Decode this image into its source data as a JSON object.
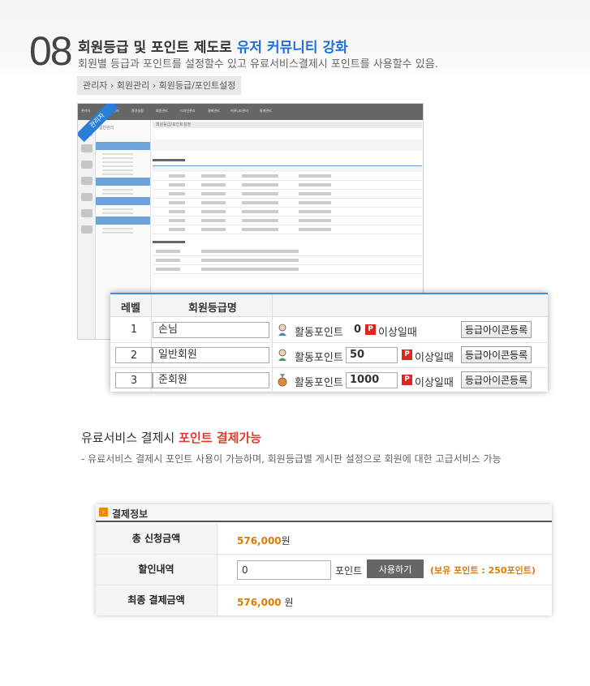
{
  "header": {
    "number": "08",
    "title": "회원등급 및 포인트 제도로",
    "title_highlight": "유저 커뮤니티 강화",
    "subtitle": "회원별 등급과 포인트를 설정할수 있고 유료서비스결제시 포인트를 사용할수 있음.",
    "breadcrumb": "관리자 › 회원관리 › 회원등급/포인트설정"
  },
  "admin_preview": {
    "ribbon": "관리자",
    "side_title": "일반관리",
    "page_heading": "회원등급/포인트설정",
    "nav": [
      "관리자",
      "일반관리",
      "환경설정",
      "회원관리",
      "디자인관리",
      "결제관리",
      "커뮤니티관리",
      "통계관리"
    ]
  },
  "grade_table": {
    "headers": {
      "level": "레벨",
      "name": "회원등급명"
    },
    "rows": [
      {
        "level": "1",
        "name": "손님",
        "label": "활동포인트",
        "points": "0",
        "condition": "이상일때",
        "button": "등급아이콘등록",
        "badge": "P"
      },
      {
        "level": "2",
        "name": "일반회원",
        "label": "활동포인트",
        "points": "50",
        "condition": "이상일때",
        "button": "등급아이콘등록",
        "badge": "P"
      },
      {
        "level": "3",
        "name": "준회원",
        "label": "활동포인트",
        "points": "1000",
        "condition": "이상일때",
        "button": "등급아이콘등록",
        "badge": "P"
      }
    ]
  },
  "section2": {
    "title": "유료서비스 결제시",
    "title_highlight": "포인트 결제가능",
    "description": "- 유료서비스 결제시 포인트 사용이 가능하며, 회원등급별 게시판 설정으로 회원에 대한 고급서비스 가능"
  },
  "payment": {
    "title": "결제정보",
    "total_label": "총 신청금액",
    "total_amount": "576,000",
    "total_unit": "원",
    "discount_label": "할인내역",
    "discount_value": "0",
    "discount_unit": "포인트",
    "use_button": "사용하기",
    "holding": "(보유 포인트 : 250포인트)",
    "final_label": "최종 결제금액",
    "final_amount": "576,000",
    "final_unit": "원"
  },
  "colors": {
    "accent_blue": "#1e6fd9",
    "accent_red": "#e23a2c",
    "accent_orange": "#e07a00",
    "badge_red": "#d9281e"
  }
}
